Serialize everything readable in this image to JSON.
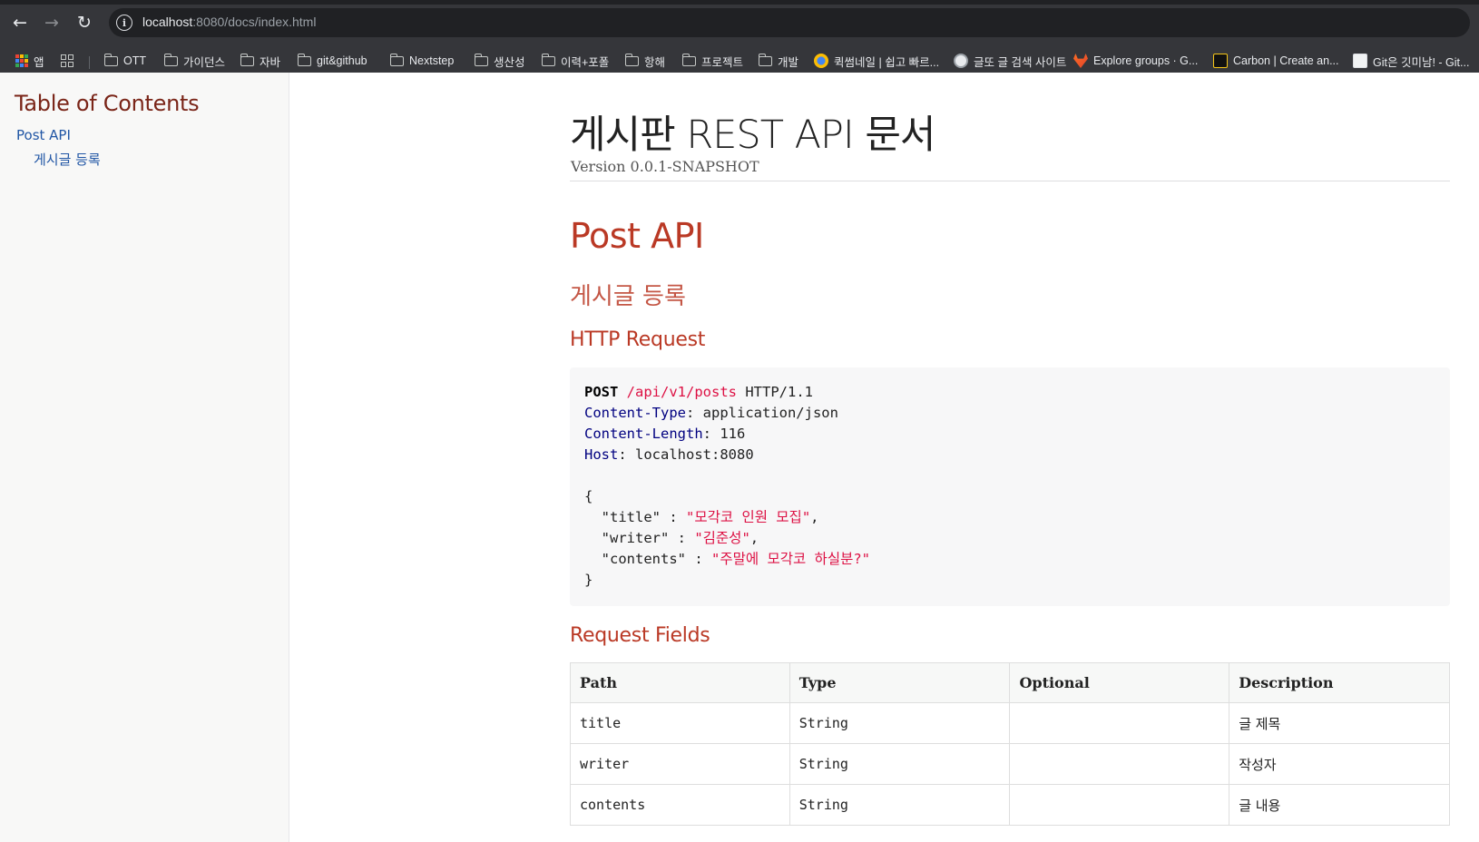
{
  "browser": {
    "url_host": "localhost",
    "url_path": ":8080/docs/index.html",
    "bookmarks": [
      {
        "label": "앱",
        "icon": "apps-icon"
      },
      {
        "label": "",
        "icon": "tab-groups-icon"
      },
      {
        "label": "OTT",
        "icon": "folder-icon"
      },
      {
        "label": "가이던스",
        "icon": "folder-icon"
      },
      {
        "label": "자바",
        "icon": "folder-icon"
      },
      {
        "label": "git&github",
        "icon": "folder-icon"
      },
      {
        "label": "Nextstep",
        "icon": "folder-icon"
      },
      {
        "label": "생산성",
        "icon": "folder-icon"
      },
      {
        "label": "이력+포폴",
        "icon": "folder-icon"
      },
      {
        "label": "항해",
        "icon": "folder-icon"
      },
      {
        "label": "프로젝트",
        "icon": "folder-icon"
      },
      {
        "label": "개발",
        "icon": "folder-icon"
      },
      {
        "label": "퀵썸네일 | 쉽고 빠르...",
        "icon": "quick-thumbnail-favicon"
      },
      {
        "label": "글또 글 검색 사이트",
        "icon": "geultto-favicon"
      },
      {
        "label": "Explore groups · G...",
        "icon": "gitlab-favicon"
      },
      {
        "label": "Carbon | Create an...",
        "icon": "carbon-favicon"
      },
      {
        "label": "Git은 깃미남! - Git...",
        "icon": "git-favicon"
      }
    ]
  },
  "toc": {
    "title": "Table of Contents",
    "items": [
      {
        "label": "Post API"
      },
      {
        "label": "게시글 등록"
      }
    ]
  },
  "doc": {
    "title": "게시판 REST API 문서",
    "version": "Version 0.0.1-SNAPSHOT",
    "section": "Post API",
    "subsection": "게시글 등록",
    "http_request_heading": "HTTP Request",
    "request": {
      "method": "POST",
      "path": "/api/v1/posts",
      "protocol": "HTTP/1.1",
      "headers": [
        {
          "name": "Content-Type",
          "value": "application/json"
        },
        {
          "name": "Content-Length",
          "value": "116"
        },
        {
          "name": "Host",
          "value": "localhost:8080"
        }
      ],
      "body_open": "{",
      "body_fields": [
        {
          "key": "\"title\"",
          "sep": " : ",
          "value": "\"모각코 인원 모집\"",
          "trail": ","
        },
        {
          "key": "\"writer\"",
          "sep": " : ",
          "value": "\"김준성\"",
          "trail": ","
        },
        {
          "key": "\"contents\"",
          "sep": " : ",
          "value": "\"주말에 모각코 하실분?\"",
          "trail": ""
        }
      ],
      "body_close": "}"
    },
    "request_fields_heading": "Request Fields",
    "table": {
      "columns": [
        "Path",
        "Type",
        "Optional",
        "Description"
      ],
      "rows": [
        {
          "path": "title",
          "type": "String",
          "optional": "",
          "description": "글 제목"
        },
        {
          "path": "writer",
          "type": "String",
          "optional": "",
          "description": "작성자"
        },
        {
          "path": "contents",
          "type": "String",
          "optional": "",
          "description": "글 내용"
        }
      ]
    }
  },
  "colors": {
    "heading": "#ba3925",
    "toc_title": "#7a2518",
    "link": "#2156a5",
    "code_string": "#dd1144",
    "code_header": "#000080"
  }
}
